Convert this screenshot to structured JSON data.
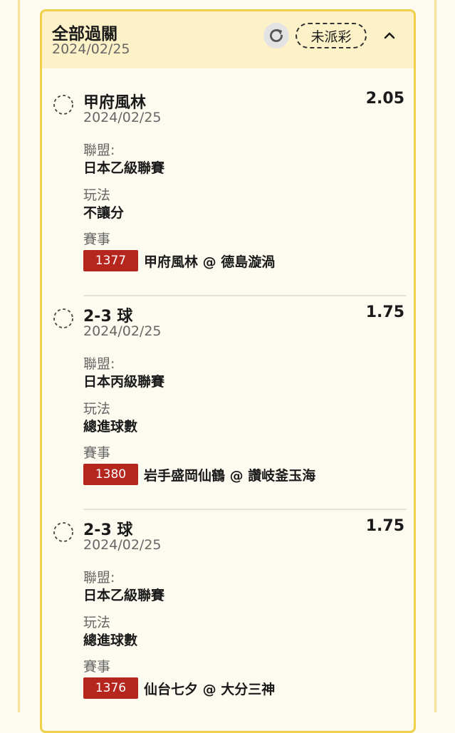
{
  "header": {
    "title": "全部過關",
    "date": "2024/02/25",
    "status_label": "未派彩"
  },
  "labels": {
    "league": "聯盟:",
    "play_type": "玩法",
    "event": "賽事"
  },
  "bets": [
    {
      "selection": "甲府風林",
      "odds": "2.05",
      "date": "2024/02/25",
      "league": "日本乙級聯賽",
      "play_type": "不讓分",
      "event_no": "1377",
      "event_teams": "甲府風林 @ 德島漩渦"
    },
    {
      "selection": "2-3 球",
      "odds": "1.75",
      "date": "2024/02/25",
      "league": "日本丙級聯賽",
      "play_type": "總進球數",
      "event_no": "1380",
      "event_teams": "岩手盛岡仙鶴 @ 讚岐釜玉海"
    },
    {
      "selection": "2-3 球",
      "odds": "1.75",
      "date": "2024/02/25",
      "league": "日本乙級聯賽",
      "play_type": "總進球數",
      "event_no": "1376",
      "event_teams": "仙台七夕 @ 大分三神"
    }
  ],
  "colors": {
    "card_border": "#f2cf4a",
    "header_bg": "#fdf1c7",
    "event_badge": "#b5261e"
  },
  "icons": {
    "refresh": "refresh-icon",
    "collapse": "chevron-up-icon",
    "pending": "pending-circle-icon"
  }
}
